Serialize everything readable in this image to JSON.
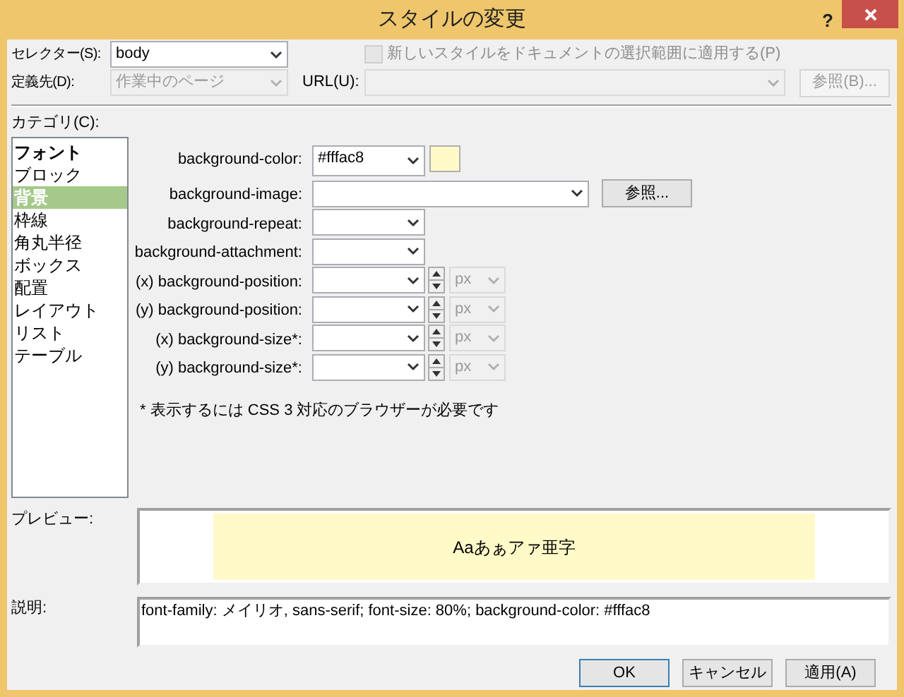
{
  "window": {
    "title": "スタイルの変更",
    "help": "?"
  },
  "selector": {
    "label": "セレクター(S):",
    "value": "body"
  },
  "apply_checkbox": {
    "label": "新しいスタイルをドキュメントの選択範囲に適用する(P)",
    "checked": false,
    "disabled": true
  },
  "define_in": {
    "label": "定義先(D):",
    "value": "作業中のページ",
    "disabled": true
  },
  "url": {
    "label": "URL(U):",
    "disabled": true
  },
  "url_browse_button": {
    "label": "参照(B)...",
    "disabled": true
  },
  "category": {
    "label": "カテゴリ(C):",
    "items": [
      {
        "label": "フォント",
        "bold": true,
        "selected": false
      },
      {
        "label": "ブロック",
        "bold": false,
        "selected": false
      },
      {
        "label": "背景",
        "bold": true,
        "selected": true
      },
      {
        "label": "枠線",
        "bold": false,
        "selected": false
      },
      {
        "label": "角丸半径",
        "bold": false,
        "selected": false
      },
      {
        "label": "ボックス",
        "bold": false,
        "selected": false
      },
      {
        "label": "配置",
        "bold": false,
        "selected": false
      },
      {
        "label": "レイアウト",
        "bold": false,
        "selected": false
      },
      {
        "label": "リスト",
        "bold": false,
        "selected": false
      },
      {
        "label": "テーブル",
        "bold": false,
        "selected": false
      }
    ]
  },
  "properties": [
    {
      "kind": "color",
      "label": "background-color:",
      "value": "#fffac8",
      "color": "#fffac8"
    },
    {
      "kind": "file",
      "label": "background-image:",
      "button": "参照..."
    },
    {
      "kind": "combo",
      "label": "background-repeat:"
    },
    {
      "kind": "combo",
      "label": "background-attachment:"
    },
    {
      "kind": "unit",
      "label": "(x) background-position:",
      "unit": "px"
    },
    {
      "kind": "unit",
      "label": "(y) background-position:",
      "unit": "px"
    },
    {
      "kind": "unit",
      "label": "(x) background-size*:",
      "unit": "px"
    },
    {
      "kind": "unit",
      "label": "(y) background-size*:",
      "unit": "px"
    }
  ],
  "note": "* 表示するには CSS 3 対応のブラウザーが必要です",
  "preview": {
    "label": "プレビュー:",
    "sample": "Aaあぁアァ亜字",
    "color": "#fffac8"
  },
  "description": {
    "label": "説明:",
    "text": "font-family: メイリオ, sans-serif; font-size: 80%; background-color: #fffac8"
  },
  "buttons": [
    {
      "label": "OK",
      "default": true
    },
    {
      "label": "キャンセル",
      "default": false
    },
    {
      "label": "適用(A)",
      "default": false
    }
  ]
}
